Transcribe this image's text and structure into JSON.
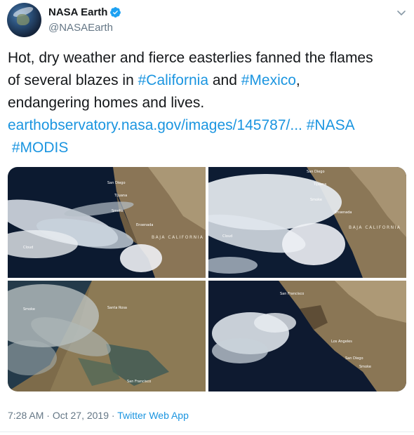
{
  "author": {
    "name": "NASA Earth",
    "handle": "@NASAEarth"
  },
  "tweet": {
    "line1": "Hot, dry weather and fierce easterlies fanned the flames",
    "line2_pre": "of several blazes in ",
    "hashtag_california": "#California",
    "line2_mid": " and ",
    "hashtag_mexico": "#Mexico",
    "line2_post": ",",
    "line3": "endangering homes and lives.",
    "link": "earthobservatory.nasa.gov/images/145787/...",
    "hashtag_nasa": "#NASA",
    "hashtag_modis": "#MODIS"
  },
  "media": {
    "panel1": {
      "labels": [
        "San Diego",
        "Tijuana",
        "Smoke",
        "Ensenada",
        "Cloud"
      ],
      "region": "BAJA CALIFORNIA"
    },
    "panel2": {
      "labels": [
        "San Diego",
        "Tijuana",
        "Smoke",
        "Ensenada",
        "Cloud"
      ],
      "region": "BAJA CALIFORNIA"
    },
    "panel3": {
      "labels": [
        "Smoke",
        "Santa Rosa",
        "San Francisco"
      ]
    },
    "panel4": {
      "labels": [
        "San Francisco",
        "Los Angeles",
        "San Diego",
        "Smoke"
      ]
    }
  },
  "footer": {
    "time": "7:28 AM",
    "separator1": " · ",
    "date": "Oct 27, 2019",
    "separator2": " · ",
    "source": "Twitter Web App"
  },
  "colors": {
    "link": "#1b95e0",
    "verified": "#1da1f2",
    "muted": "#657786"
  },
  "icons": {
    "verified": "verified-badge-icon",
    "caret": "chevron-down-icon"
  }
}
